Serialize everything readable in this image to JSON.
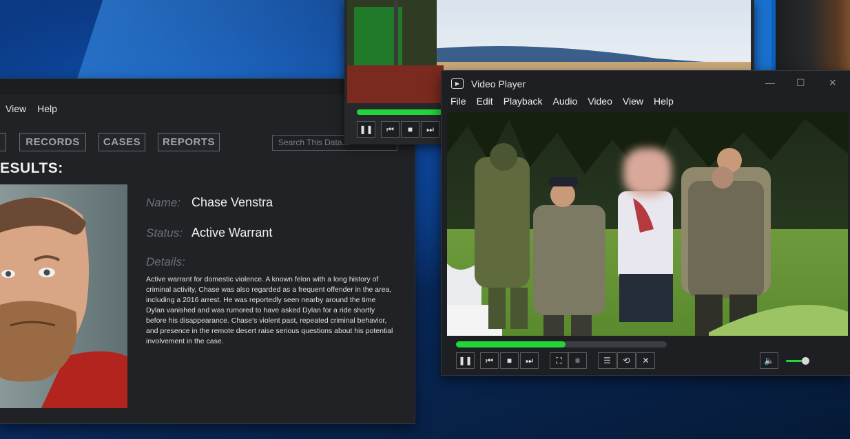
{
  "database_window": {
    "menu": [
      "View",
      "Help"
    ],
    "nav": [
      {
        "label": "RECORDS"
      },
      {
        "label": "CASES"
      },
      {
        "label": "REPORTS"
      }
    ],
    "search": {
      "placeholder": "Search This Data..."
    },
    "results_title": "ESULTS:",
    "record": {
      "name_label": "Name:",
      "name_value": "Chase Venstra",
      "status_label": "Status:",
      "status_value": "Active Warrant",
      "details_label": "Details:",
      "details_text": "Active warrant for domestic violence. A known felon with a long history of criminal activity, Chase was also regarded as a frequent offender in the area, including a 2016 arrest. He was reportedly seen nearby around the time Dylan vanished and was rumored to have asked Dylan for a ride shortly before his disappearance. Chase's violent past, repeated criminal behavior, and presence in the remote desert raise serious questions about his potential involvement in the case."
    }
  },
  "video_player": {
    "title": "Video Player",
    "menu": [
      "File",
      "Edit",
      "Playback",
      "Audio",
      "Video",
      "View",
      "Help"
    ],
    "progress": 0.52,
    "volume": 0.7,
    "accent_color": "#22d63a",
    "controls": [
      "pause-icon",
      "skip-back-icon",
      "stop-icon",
      "skip-forward-icon",
      "fullscreen-icon",
      "equalizer-icon",
      "playlist-icon",
      "repeat-icon",
      "shuffle-icon",
      "volume-icon"
    ]
  },
  "small_player": {
    "progress": 0.9,
    "controls": [
      "pause-icon",
      "skip-back-icon",
      "stop-icon",
      "skip-forward-icon"
    ]
  }
}
